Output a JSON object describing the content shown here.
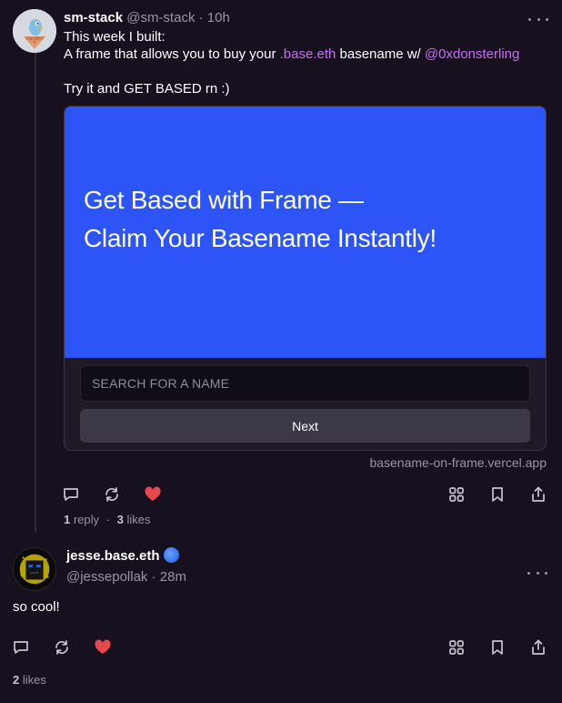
{
  "post": {
    "author_name": "sm-stack",
    "author_handle": "@sm-stack",
    "separator": "·",
    "time": "10h",
    "line1": "This week I built:",
    "line2_prefix": "A frame that allows you to buy your ",
    "line2_link1": ".base.eth",
    "line2_mid": " basename w/ ",
    "line2_link2": "@0xdonsterling",
    "line3": "Try it and GET BASED rn :)",
    "frame": {
      "headline_line1": "Get Based with Frame —",
      "headline_line2": "Claim Your Basename Instantly!",
      "input_placeholder": "SEARCH FOR A NAME",
      "button_label": "Next",
      "domain": "basename-on-frame.vercel.app",
      "image_color": "#2c54f6"
    },
    "stats": {
      "replies_count": "1",
      "replies_label": "reply",
      "dot": "·",
      "likes_count": "3",
      "likes_label": "likes"
    }
  },
  "reply": {
    "author_name": "jesse.base.eth",
    "author_handle": "@jessepollak",
    "separator": "·",
    "time": "28m",
    "text": "so cool!",
    "stats": {
      "likes_count": "2",
      "likes_label": "likes"
    }
  },
  "icons": {
    "reply": "comment-icon",
    "recast": "recast-icon",
    "like": "heart-icon",
    "grid": "grid-icon",
    "bookmark": "bookmark-icon",
    "share": "share-icon",
    "more": "more-icon",
    "verified": "verified-badge-icon"
  },
  "colors": {
    "background": "#17101f",
    "link": "#c96cf0",
    "like": "#e5484d",
    "muted": "#9a95a3"
  }
}
